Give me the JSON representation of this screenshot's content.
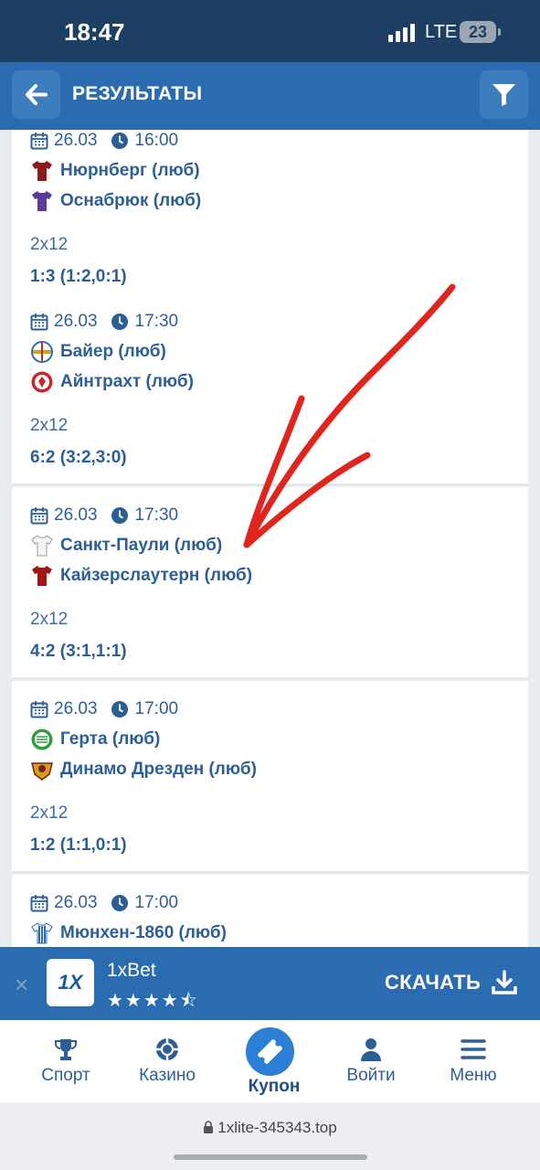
{
  "status_bar": {
    "time": "18:47",
    "network": "LTE",
    "battery": "23"
  },
  "header": {
    "title": "РЕЗУЛЬТАТЫ"
  },
  "matches": [
    {
      "date": "26.03",
      "time": "16:00",
      "home": "Нюрнберг (люб)",
      "away": "Оснабрюк (люб)",
      "type": "2x12",
      "score": "1:3 (1:2,0:1)"
    },
    {
      "date": "26.03",
      "time": "17:30",
      "home": "Байер (люб)",
      "away": "Айнтрахт (люб)",
      "type": "2x12",
      "score": "6:2 (3:2,3:0)"
    },
    {
      "date": "26.03",
      "time": "17:30",
      "home": "Санкт-Паули (люб)",
      "away": "Кайзерслаутерн (люб)",
      "type": "2x12",
      "score": "4:2 (3:1,1:1)"
    },
    {
      "date": "26.03",
      "time": "17:00",
      "home": "Герта (люб)",
      "away": "Динамо Дрезден (люб)",
      "type": "2x12",
      "score": "1:2 (1:1,0:1)"
    },
    {
      "date": "26.03",
      "time": "17:00",
      "home": "Мюнхен-1860 (люб)",
      "away": "",
      "type": "",
      "score": ""
    }
  ],
  "banner": {
    "close": "×",
    "logo": "1X",
    "app_name": "1xBet",
    "rating": 4.5,
    "stars": "★★★★⯪",
    "download_label": "СКАЧАТЬ"
  },
  "nav": {
    "sport": "Спорт",
    "casino": "Казино",
    "coupon": "Купон",
    "login": "Войти",
    "menu": "Меню"
  },
  "browser": {
    "url": "1xlite-345343.top"
  },
  "colors": {
    "header": "#2b6cb0",
    "status_bar": "#1c3f63",
    "text": "#2d5f97",
    "annotation": "#e0251f"
  }
}
